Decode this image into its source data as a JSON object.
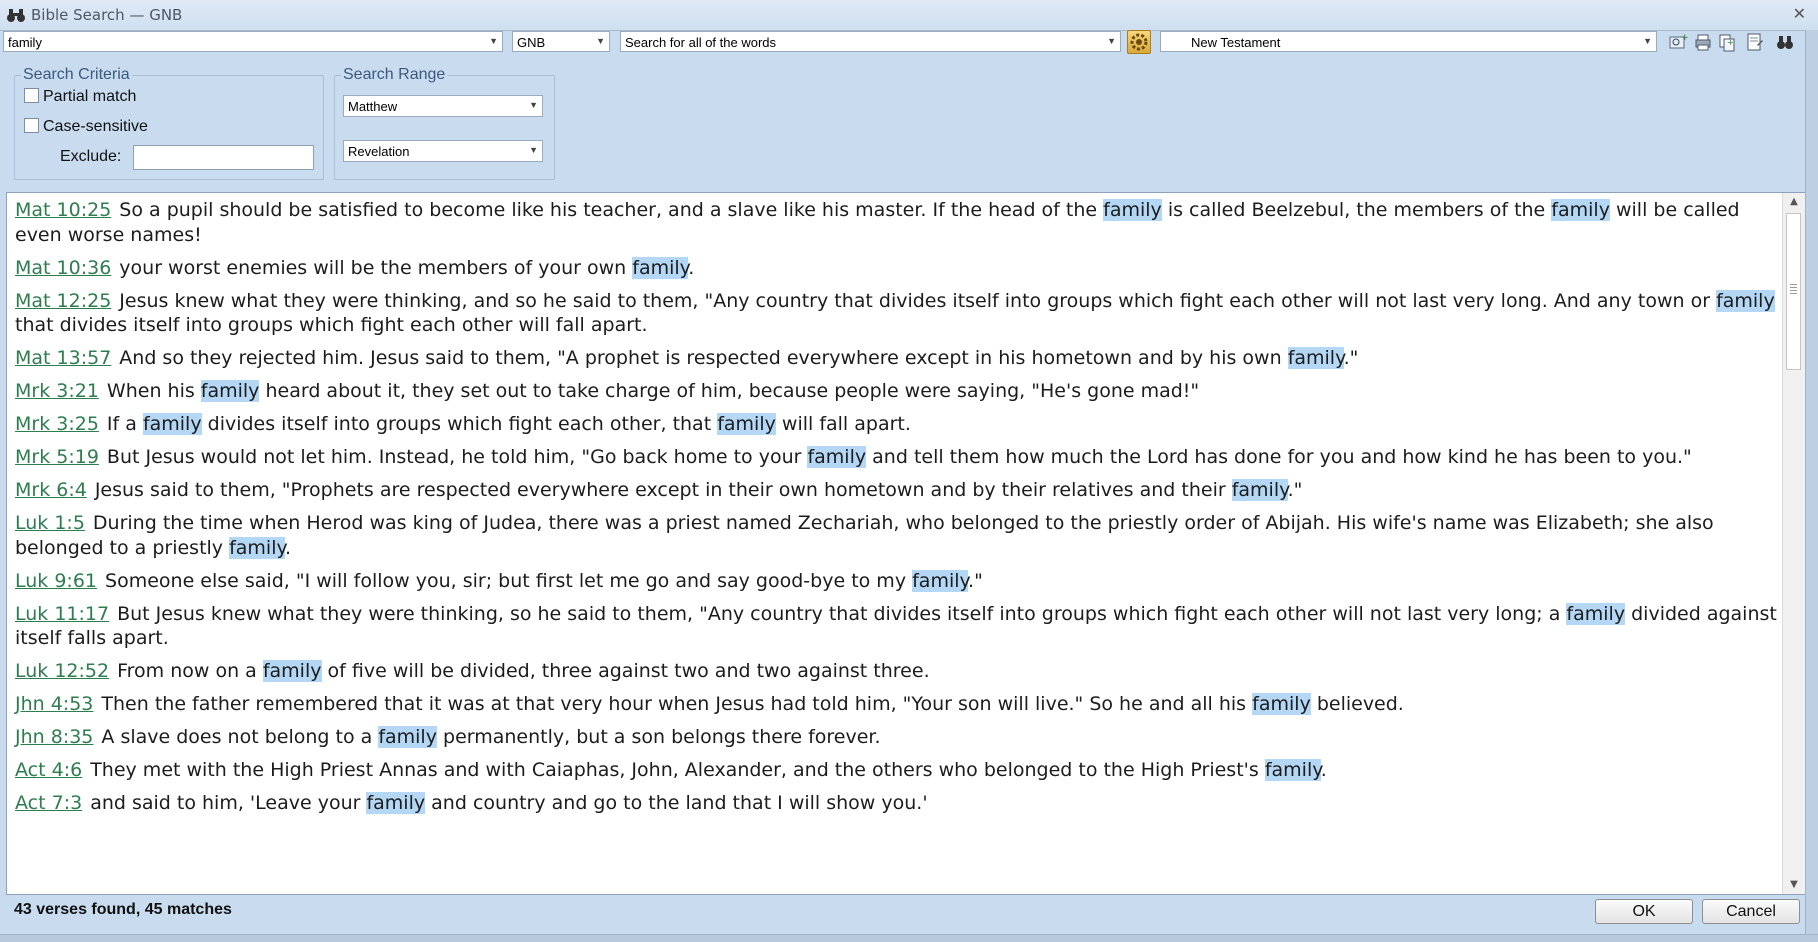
{
  "window": {
    "title": "Bible Search — GNB",
    "close_glyph": "✕"
  },
  "toolbar": {
    "search_text": "family",
    "version": "GNB",
    "search_mode": "Search for all of the words",
    "range": "New Testament",
    "icons": [
      "search-add-icon",
      "print-icon",
      "copy-icon",
      "export-icon",
      "binoculars-icon"
    ]
  },
  "criteria": {
    "legend": "Search Criteria",
    "partial_match": "Partial match",
    "case_sensitive": "Case-sensitive",
    "exclude_label": "Exclude:",
    "exclude_value": ""
  },
  "range_group": {
    "legend": "Search Range",
    "from": "Matthew",
    "to": "Revelation"
  },
  "verses": [
    {
      "ref": "Mat 10:25",
      "parts": [
        "So a pupil should be satisfied to become like his teacher, and a slave like his master. If the head of the ",
        "family",
        " is called Beelzebul, the members of the ",
        "family",
        " will be called even worse names!"
      ]
    },
    {
      "ref": "Mat 10:36",
      "parts": [
        "your worst enemies will be the members of your own ",
        "family",
        "."
      ]
    },
    {
      "ref": "Mat 12:25",
      "parts": [
        "Jesus knew what they were thinking, and so he said to them, \"Any country that divides itself into groups which fight each other will not last very long. And any town or ",
        "family",
        " that divides itself into groups which fight each other will fall apart."
      ]
    },
    {
      "ref": "Mat 13:57",
      "parts": [
        "And so they rejected him. Jesus said to them, \"A prophet is respected everywhere except in his hometown and by his own ",
        "family",
        ".\""
      ]
    },
    {
      "ref": "Mrk 3:21",
      "parts": [
        "When his ",
        "family",
        " heard about it, they set out to take charge of him, because people were saying, \"He's gone mad!\""
      ]
    },
    {
      "ref": "Mrk 3:25",
      "parts": [
        "If a ",
        "family",
        " divides itself into groups which fight each other, that ",
        "family",
        " will fall apart."
      ]
    },
    {
      "ref": "Mrk 5:19",
      "parts": [
        "But Jesus would not let him. Instead, he told him, \"Go back home to your ",
        "family",
        " and tell them how much the Lord has done for you and how kind he has been to you.\""
      ]
    },
    {
      "ref": "Mrk 6:4",
      "parts": [
        "Jesus said to them, \"Prophets are respected everywhere except in their own hometown and by their relatives and their ",
        "family",
        ".\""
      ]
    },
    {
      "ref": "Luk 1:5",
      "parts": [
        "During the time when Herod was king of Judea, there was a priest named Zechariah, who belonged to the priestly order of Abijah. His wife's name was Elizabeth; she also belonged to a priestly ",
        "family",
        "."
      ]
    },
    {
      "ref": "Luk 9:61",
      "parts": [
        "Someone else said, \"I will follow you, sir; but first let me go and say good-bye to my ",
        "family",
        ".\""
      ]
    },
    {
      "ref": "Luk 11:17",
      "parts": [
        "But Jesus knew what they were thinking, so he said to them, \"Any country that divides itself into groups which fight each other will not last very long; a ",
        "family",
        " divided against itself falls apart."
      ]
    },
    {
      "ref": "Luk 12:52",
      "parts": [
        "From now on a ",
        "family",
        " of five will be divided, three against two and two against three."
      ]
    },
    {
      "ref": "Jhn 4:53",
      "parts": [
        "Then the father remembered that it was at that very hour when Jesus had told him, \"Your son will live.\" So he and all his ",
        "family",
        " believed."
      ]
    },
    {
      "ref": "Jhn 8:35",
      "parts": [
        "A slave does not belong to a ",
        "family",
        " permanently, but a son belongs there forever."
      ]
    },
    {
      "ref": "Act 4:6",
      "parts": [
        "They met with the High Priest Annas and with Caiaphas, John, Alexander, and the others who belonged to the High Priest's ",
        "family",
        "."
      ]
    },
    {
      "ref": "Act 7:3",
      "parts": [
        "and said to him, 'Leave your ",
        "family",
        " and country and go to the land that I will show you.'"
      ]
    }
  ],
  "status": "43 verses found, 45 matches",
  "buttons": {
    "ok": "OK",
    "cancel": "Cancel"
  },
  "colors": {
    "highlight": "#b3d7f5",
    "ref_link": "#2e7d4f",
    "window_bg": "#c9dcef"
  }
}
